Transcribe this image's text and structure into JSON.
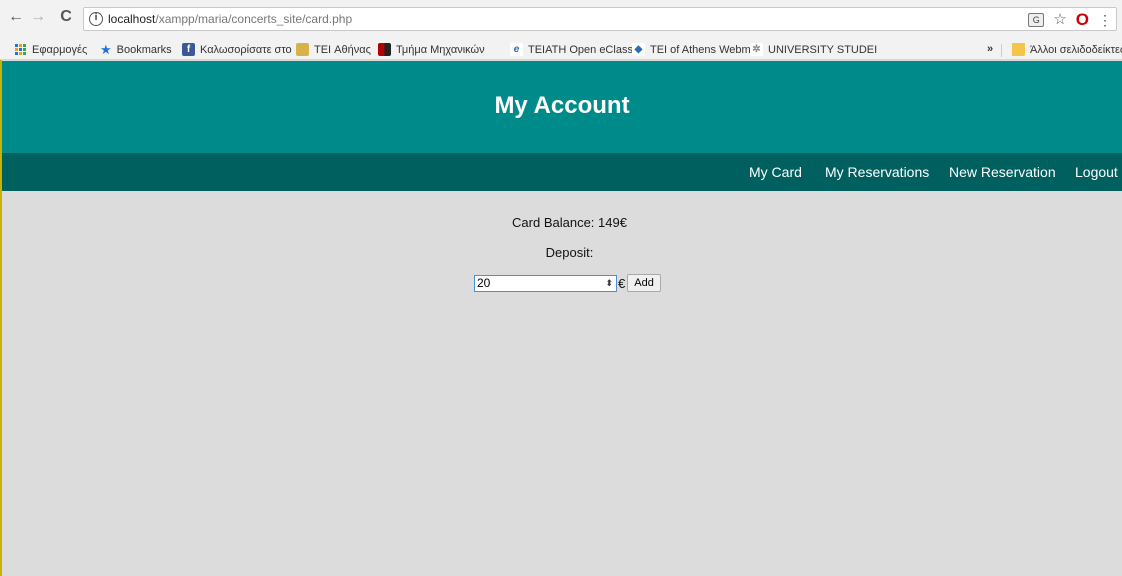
{
  "browser": {
    "url_host": "localhost",
    "url_path": "/xampp/maria/concerts_site/card.php",
    "info_icon": "i",
    "back_icon": "←",
    "forward_icon": "→",
    "reload_icon": "C",
    "menu_icon": "⋮",
    "star_icon": "☆",
    "opera_icon": "O",
    "translate_icon": "G"
  },
  "bookmarks": {
    "apps": "Εφαρμογές",
    "items": [
      {
        "label": "Bookmarks",
        "icon": "star-icon"
      },
      {
        "label": "Καλωσορίσατε στο",
        "icon": "facebook-icon"
      },
      {
        "label": "TEI Αθήνας",
        "icon": "tei-icon"
      },
      {
        "label": "Τμήμα Μηχανικών",
        "icon": "department-icon"
      },
      {
        "label": "TEIATH Open eClass",
        "icon": "eclass-icon"
      },
      {
        "label": "TEI of Athens Webm",
        "icon": "webmail-icon"
      },
      {
        "label": "UNIVERSITY STUDEI",
        "icon": "university-icon"
      }
    ],
    "overflow": "»",
    "other": "Άλλοι σελιδοδείκτες"
  },
  "site": {
    "title": "My Account",
    "nav": {
      "my_card": "My Card",
      "my_reservations": "My Reservations",
      "new_reservation": "New Reservation",
      "logout": "Logout"
    }
  },
  "card": {
    "balance": "Card Balance: 149€",
    "deposit_label": "Deposit:",
    "deposit_value": "20",
    "currency": "€",
    "add_label": "Add"
  },
  "colors": {
    "header": "#008b8b",
    "nav": "#006060",
    "content": "#dcdcdc"
  }
}
